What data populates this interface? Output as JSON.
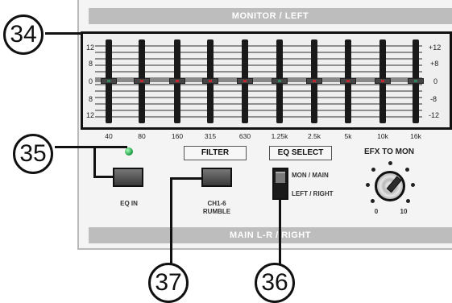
{
  "bands": {
    "top": "MONITOR / LEFT",
    "bottom": "MAIN L-R / RIGHT"
  },
  "scale": {
    "left": [
      "12",
      "8",
      "0",
      "8",
      "12"
    ],
    "right": [
      "+12",
      "+8",
      "0",
      "-8",
      "-12"
    ]
  },
  "frequencies": [
    "40",
    "80",
    "160",
    "315",
    "630",
    "1.25k",
    "2.5k",
    "5k",
    "10k",
    "16k"
  ],
  "labels": {
    "filter": "FILTER",
    "eq_select": "EQ SELECT",
    "efx_to_mon": "EFX TO MON",
    "eq_in": "EQ IN",
    "ch16_line1": "CH1-6",
    "ch16_line2": "RUMBLE",
    "mon_main": "MON / MAIN",
    "left_right": "LEFT / RIGHT",
    "knob_min": "0",
    "knob_max": "10"
  },
  "callouts": [
    "34",
    "35",
    "36",
    "37"
  ],
  "controls": {
    "eq_in_led_color": "#1f9f4a",
    "eq_in_button_state": "off",
    "rumble_button_state": "off",
    "eq_select_position": "MON / MAIN",
    "efx_to_mon_level": 0.7
  }
}
